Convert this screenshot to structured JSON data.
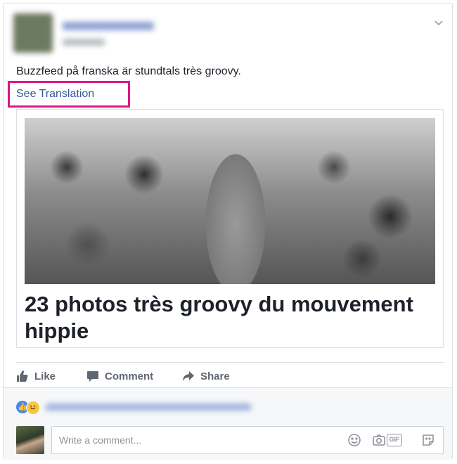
{
  "post": {
    "text": "Buzzfeed på franska är stundtals très groovy.",
    "translate_link": "See Translation"
  },
  "link_card": {
    "title": "23 photos très groovy du mouvement hippie"
  },
  "actions": {
    "like_label": "Like",
    "comment_label": "Comment",
    "share_label": "Share"
  },
  "comment_box": {
    "placeholder": "Write a comment..."
  },
  "icons": {
    "menu": "chevron-down-icon",
    "like": "thumbs-up-icon",
    "comment": "speech-bubble-icon",
    "share": "share-arrow-icon",
    "emoji": "smiley-icon",
    "camera": "camera-icon",
    "gif": "gif-icon",
    "sticker": "sticker-icon"
  },
  "colors": {
    "link": "#385898",
    "highlight": "#e0168a",
    "action_text": "#606770",
    "reaction_like": "#4b87f0",
    "reaction_haha": "#f7c844"
  }
}
